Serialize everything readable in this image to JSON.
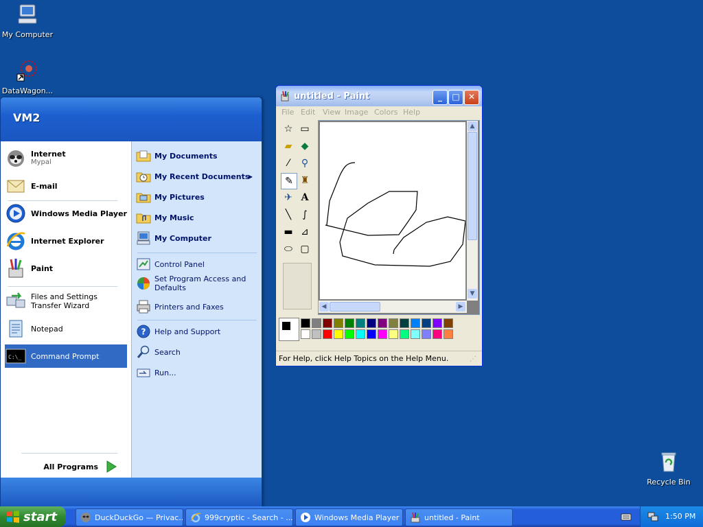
{
  "desktop": {
    "icons": [
      {
        "label": "My Computer",
        "icon": "my-computer-icon"
      },
      {
        "label": "DataWagon...",
        "icon": "datawagon-icon"
      },
      {
        "label": "Recycle Bin",
        "icon": "recycle-bin-icon"
      }
    ]
  },
  "start_menu": {
    "user": "VM2",
    "pinned": [
      {
        "label": "Internet",
        "sub": "Mypal",
        "icon": "mypal-icon"
      },
      {
        "label": "E-mail",
        "icon": "email-icon"
      }
    ],
    "recent": [
      {
        "label": "Windows Media Player",
        "icon": "media-player-icon"
      },
      {
        "label": "Internet Explorer",
        "icon": "ie-icon"
      },
      {
        "label": "Paint",
        "icon": "paint-icon"
      },
      {
        "label": "Files and Settings Transfer Wizard",
        "icon": "transfer-wizard-icon"
      },
      {
        "label": "Notepad",
        "icon": "notepad-icon"
      },
      {
        "label": "Command Prompt",
        "icon": "cmd-icon"
      }
    ],
    "all_programs": "All Programs",
    "right": {
      "my_documents": "My Documents",
      "my_recent_documents": "My Recent Documents",
      "my_pictures": "My Pictures",
      "my_music": "My Music",
      "my_computer": "My Computer",
      "control_panel": "Control Panel",
      "set_program_access": "Set Program Access and Defaults",
      "printers": "Printers and Faxes",
      "help": "Help and Support",
      "search": "Search",
      "run": "Run..."
    }
  },
  "paint": {
    "title": "untitled - Paint",
    "menus": [
      "File",
      "Edit",
      "View",
      "Image",
      "Colors",
      "Help"
    ],
    "status": "For Help, click Help Topics on the Help Menu.",
    "palette_top": [
      "#000000",
      "#808080",
      "#800000",
      "#808000",
      "#008000",
      "#008080",
      "#000080",
      "#800080",
      "#808040",
      "#004040",
      "#0080ff",
      "#004080",
      "#8000ff",
      "#804000"
    ],
    "palette_bottom": [
      "#ffffff",
      "#c0c0c0",
      "#ff0000",
      "#ffff00",
      "#00ff00",
      "#00ffff",
      "#0000ff",
      "#ff00ff",
      "#ffff80",
      "#00ff80",
      "#80ffff",
      "#8080ff",
      "#ff0080",
      "#ff8040"
    ]
  },
  "taskbar": {
    "start_label": "start",
    "tasks": [
      {
        "label": "DuckDuckGo — Privac...",
        "icon": "duckduckgo-icon"
      },
      {
        "label": "999cryptic - Search - ...",
        "icon": "ie-icon"
      },
      {
        "label": "Windows Media Player",
        "icon": "media-player-icon"
      },
      {
        "label": "untitled - Paint",
        "icon": "paint-icon"
      }
    ],
    "clock": "1:50 PM"
  },
  "colors": {
    "desktop": "#0d4d9c",
    "start_green": "#2f8a2f",
    "taskbar_blue": "#245edb",
    "highlight": "#316ac5"
  }
}
